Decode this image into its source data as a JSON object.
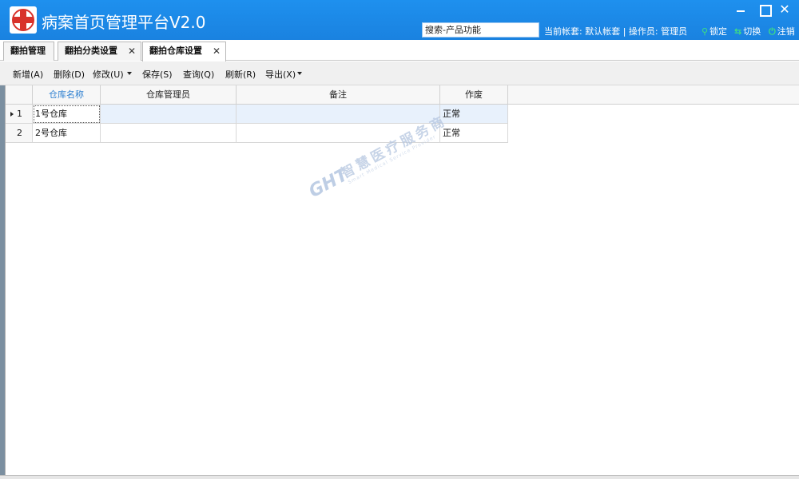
{
  "app": {
    "title": "病案首页管理平台V2.0",
    "search_value": "搜索-产品功能",
    "account_info": "当前帐套: 默认帐套 | 操作员: 管理员",
    "actions": [
      {
        "label": "锁定",
        "icon": "lock-icon"
      },
      {
        "label": "切换",
        "icon": "switch-icon"
      },
      {
        "label": "注销",
        "icon": "power-icon"
      }
    ],
    "window_controls": {
      "minimize": "minimize-icon",
      "maximize": "maximize-icon",
      "close": "✕"
    }
  },
  "tabs": [
    {
      "label": "翻拍管理",
      "closable": false
    },
    {
      "label": "翻拍分类设置",
      "closable": true,
      "close": "✕"
    },
    {
      "label": "翻拍仓库设置",
      "closable": true,
      "close": "✕",
      "active": true
    }
  ],
  "toolbar": {
    "new": "新增(A)",
    "delete": "删除(D)",
    "modify": "修改(U)",
    "save": "保存(S)",
    "query": "查询(Q)",
    "refresh": "刷新(R)",
    "export": "导出(X)"
  },
  "grid": {
    "columns": [
      "仓库名称",
      "仓库管理员",
      "备注",
      "作废"
    ],
    "rows": [
      {
        "num": "1",
        "name": "1号仓库",
        "manager": "",
        "remark": "",
        "void": "正常"
      },
      {
        "num": "2",
        "name": "2号仓库",
        "manager": "",
        "remark": "",
        "void": "正常"
      }
    ]
  },
  "watermark": {
    "logo": "GHT",
    "text": "智慧医疗服务商",
    "sub": "Smart Medical Service Provider"
  },
  "colors": {
    "titlebar": "#1e90ee",
    "selected_row": "#e8f1fc",
    "sorted_header": "#2d7fd0"
  }
}
